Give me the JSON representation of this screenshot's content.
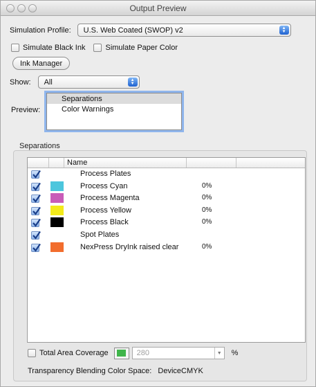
{
  "window": {
    "title": "Output Preview"
  },
  "simulation": {
    "label": "Simulation Profile:",
    "value": "U.S. Web Coated (SWOP) v2"
  },
  "options": {
    "simulate_black_ink": "Simulate Black Ink",
    "simulate_paper_color": "Simulate Paper Color"
  },
  "ink_manager": {
    "label": "Ink Manager"
  },
  "show": {
    "label": "Show:",
    "value": "All"
  },
  "preview": {
    "label": "Preview:",
    "items": [
      "Separations",
      "Color Warnings"
    ]
  },
  "separations": {
    "group_label": "Separations",
    "column_name": "Name",
    "rows": [
      {
        "name": "Process Plates",
        "percent": "",
        "color": ""
      },
      {
        "name": "Process Cyan",
        "percent": "0%",
        "color": "#4cc6dd"
      },
      {
        "name": "Process Magenta",
        "percent": "0%",
        "color": "#c85cb8"
      },
      {
        "name": "Process Yellow",
        "percent": "0%",
        "color": "#f3ea1a"
      },
      {
        "name": "Process Black",
        "percent": "0%",
        "color": "#000000"
      },
      {
        "name": "Spot Plates",
        "percent": "",
        "color": ""
      },
      {
        "name": "NexPress DryInk raised clear",
        "percent": "0%",
        "color": "#f26d2d"
      }
    ]
  },
  "coverage": {
    "label": "Total Area Coverage",
    "value": "280",
    "unit": "%",
    "swatch_color": "#3fb54a"
  },
  "footer": {
    "label": "Transparency Blending Color Space:",
    "value": "DeviceCMYK"
  }
}
